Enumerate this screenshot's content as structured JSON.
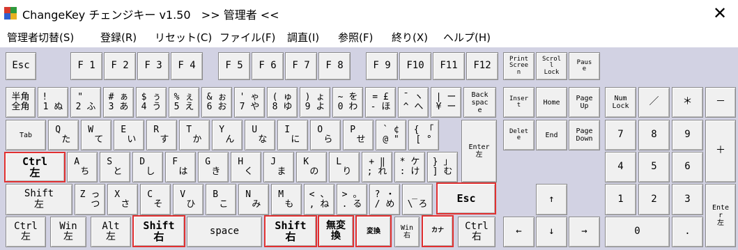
{
  "window": {
    "title": "ChangeKey チェンジキー v1.50   >> 管理者 <<",
    "close_glyph": "✕"
  },
  "menu": [
    {
      "id": "kanri",
      "label": "管理者切替(S)"
    },
    {
      "id": "touroku",
      "label": "登録(R)"
    },
    {
      "id": "reset",
      "label": "リセット(C)"
    },
    {
      "id": "file",
      "label": "ファイル(F)"
    },
    {
      "id": "chousei",
      "label": "調直(I)"
    },
    {
      "id": "sanshou",
      "label": "参照(F)"
    },
    {
      "id": "owari",
      "label": "終り(X)"
    },
    {
      "id": "help",
      "label": "ヘルプ(H)"
    }
  ],
  "colors": {
    "keyboard_bg": "#d2d2e3",
    "key_face": "#f0f0f0",
    "highlight_border": "#e03030",
    "icon": [
      "#d63a2e",
      "#2e9a3c",
      "#2f5fd1",
      "#e8b021"
    ]
  },
  "keys": [
    {
      "id": "esc",
      "label": "Esc"
    },
    {
      "id": "f1",
      "label": "F 1"
    },
    {
      "id": "f2",
      "label": "F 2"
    },
    {
      "id": "f3",
      "label": "F 3"
    },
    {
      "id": "f4",
      "label": "F 4"
    },
    {
      "id": "f5",
      "label": "F 5"
    },
    {
      "id": "f6",
      "label": "F 6"
    },
    {
      "id": "f7",
      "label": "F 7"
    },
    {
      "id": "f8",
      "label": "F 8"
    },
    {
      "id": "f9",
      "label": "F 9"
    },
    {
      "id": "f10",
      "label": "F10"
    },
    {
      "id": "f11",
      "label": "F11"
    },
    {
      "id": "f12",
      "label": "F12"
    },
    {
      "id": "printscreen",
      "label": "Print\nScree\nn"
    },
    {
      "id": "scrolllock",
      "label": "Scrol\nl\nLock"
    },
    {
      "id": "pause",
      "label": "Paus\ne"
    },
    {
      "id": "hankaku",
      "label": "半角\n全角"
    },
    {
      "id": "1",
      "label": "!   \n1 ぬ"
    },
    {
      "id": "2",
      "label": "\"  \n2 ふ"
    },
    {
      "id": "3",
      "label": "# ぁ\n3 あ"
    },
    {
      "id": "4",
      "label": "$ ぅ\n4 う"
    },
    {
      "id": "5",
      "label": "% ぇ\n5 え"
    },
    {
      "id": "6",
      "label": "& ぉ\n6 お"
    },
    {
      "id": "7",
      "label": "' ゃ\n7 や"
    },
    {
      "id": "8",
      "label": "( ゅ\n8 ゆ"
    },
    {
      "id": "9",
      "label": ") ょ\n9 よ"
    },
    {
      "id": "0",
      "label": "~ を\n0 わ"
    },
    {
      "id": "minus",
      "label": "= £\n- ほ"
    },
    {
      "id": "caret",
      "label": "¯ ヽ\n^ へ"
    },
    {
      "id": "yen",
      "label": "| ー\n¥ ー"
    },
    {
      "id": "backspace",
      "label": "Back\nspac\ne"
    },
    {
      "id": "insert",
      "label": "Inser\nt"
    },
    {
      "id": "home",
      "label": "Home"
    },
    {
      "id": "pageup",
      "label": "Page\nUp"
    },
    {
      "id": "numlock",
      "label": "Num\nLock"
    },
    {
      "id": "num_div",
      "label": "／"
    },
    {
      "id": "num_mul",
      "label": "＊"
    },
    {
      "id": "num_sub",
      "label": "－"
    },
    {
      "id": "tab",
      "label": "Tab"
    },
    {
      "id": "q",
      "label": "Q  \n た"
    },
    {
      "id": "w",
      "label": "W  \n て"
    },
    {
      "id": "e",
      "label": "E  \n い"
    },
    {
      "id": "r",
      "label": "R  \n す"
    },
    {
      "id": "t",
      "label": "T  \n か"
    },
    {
      "id": "y",
      "label": "Y  \n ん"
    },
    {
      "id": "u",
      "label": "U  \n な"
    },
    {
      "id": "i",
      "label": "I  \n に"
    },
    {
      "id": "o",
      "label": "O  \n ら"
    },
    {
      "id": "p",
      "label": "P  \n せ"
    },
    {
      "id": "at",
      "label": "` ¢\n@ \""
    },
    {
      "id": "bracket_l",
      "label": "{ 「\n[ °"
    },
    {
      "id": "enter",
      "label": "Enter\n左"
    },
    {
      "id": "delete",
      "label": "Delet\ne"
    },
    {
      "id": "end",
      "label": "End"
    },
    {
      "id": "pagedown",
      "label": "Page\nDown"
    },
    {
      "id": "num7",
      "label": "7"
    },
    {
      "id": "num8",
      "label": "8"
    },
    {
      "id": "num9",
      "label": "9"
    },
    {
      "id": "num_add",
      "label": "＋"
    },
    {
      "id": "ctrl_l",
      "label": "Ctrl\n左"
    },
    {
      "id": "a",
      "label": "A  \n ち"
    },
    {
      "id": "s",
      "label": "S  \n と"
    },
    {
      "id": "d",
      "label": "D  \n し"
    },
    {
      "id": "f",
      "label": "F  \n は"
    },
    {
      "id": "g",
      "label": "G  \n き"
    },
    {
      "id": "h",
      "label": "H  \n く"
    },
    {
      "id": "j",
      "label": "J  \n ま"
    },
    {
      "id": "k",
      "label": "K  \n の"
    },
    {
      "id": "l",
      "label": "L  \n り"
    },
    {
      "id": "semicolon",
      "label": "+ ‖\n; れ"
    },
    {
      "id": "colon",
      "label": "* ケ\n: け"
    },
    {
      "id": "bracket_r",
      "label": "} 」\n] む"
    },
    {
      "id": "num4",
      "label": "4"
    },
    {
      "id": "num5",
      "label": "5"
    },
    {
      "id": "num6",
      "label": "6"
    },
    {
      "id": "shift_l",
      "label": "Shift\n左"
    },
    {
      "id": "z",
      "label": "Z っ\n  つ"
    },
    {
      "id": "x",
      "label": "X  \n さ"
    },
    {
      "id": "c",
      "label": "C  \n そ"
    },
    {
      "id": "v",
      "label": "V  \n ひ"
    },
    {
      "id": "b",
      "label": "B  \n こ"
    },
    {
      "id": "n",
      "label": "N  \n み"
    },
    {
      "id": "m",
      "label": "M  \n も"
    },
    {
      "id": "comma",
      "label": "< 、\n, ね"
    },
    {
      "id": "period",
      "label": "> 。\n. る"
    },
    {
      "id": "slash",
      "label": "? ・\n/ め"
    },
    {
      "id": "backslash",
      "label": "_ \n\\ ろ"
    },
    {
      "id": "esc2",
      "label": "Esc"
    },
    {
      "id": "arrow_up",
      "label": "↑"
    },
    {
      "id": "num1",
      "label": "1"
    },
    {
      "id": "num2",
      "label": "2"
    },
    {
      "id": "num3",
      "label": "3"
    },
    {
      "id": "num_enter",
      "label": "Ente\nr\n左"
    },
    {
      "id": "ctrl_l2",
      "label": "Ctrl\n左"
    },
    {
      "id": "win_l",
      "label": "Win\n左"
    },
    {
      "id": "alt_l",
      "label": "Alt\n左"
    },
    {
      "id": "shift_r_mod",
      "label": "Shift\n右"
    },
    {
      "id": "space",
      "label": "space"
    },
    {
      "id": "shift_r",
      "label": "Shift\n右"
    },
    {
      "id": "muhenkan",
      "label": "無変\n換"
    },
    {
      "id": "henkan",
      "label": "変換"
    },
    {
      "id": "win_r",
      "label": "Win\n右"
    },
    {
      "id": "kana",
      "label": "カナ"
    },
    {
      "id": "ctrl_r",
      "label": "Ctrl\n右"
    },
    {
      "id": "arrow_left",
      "label": "←"
    },
    {
      "id": "arrow_down",
      "label": "↓"
    },
    {
      "id": "arrow_right",
      "label": "→"
    },
    {
      "id": "num0",
      "label": "0"
    },
    {
      "id": "num_dot",
      "label": "."
    }
  ]
}
